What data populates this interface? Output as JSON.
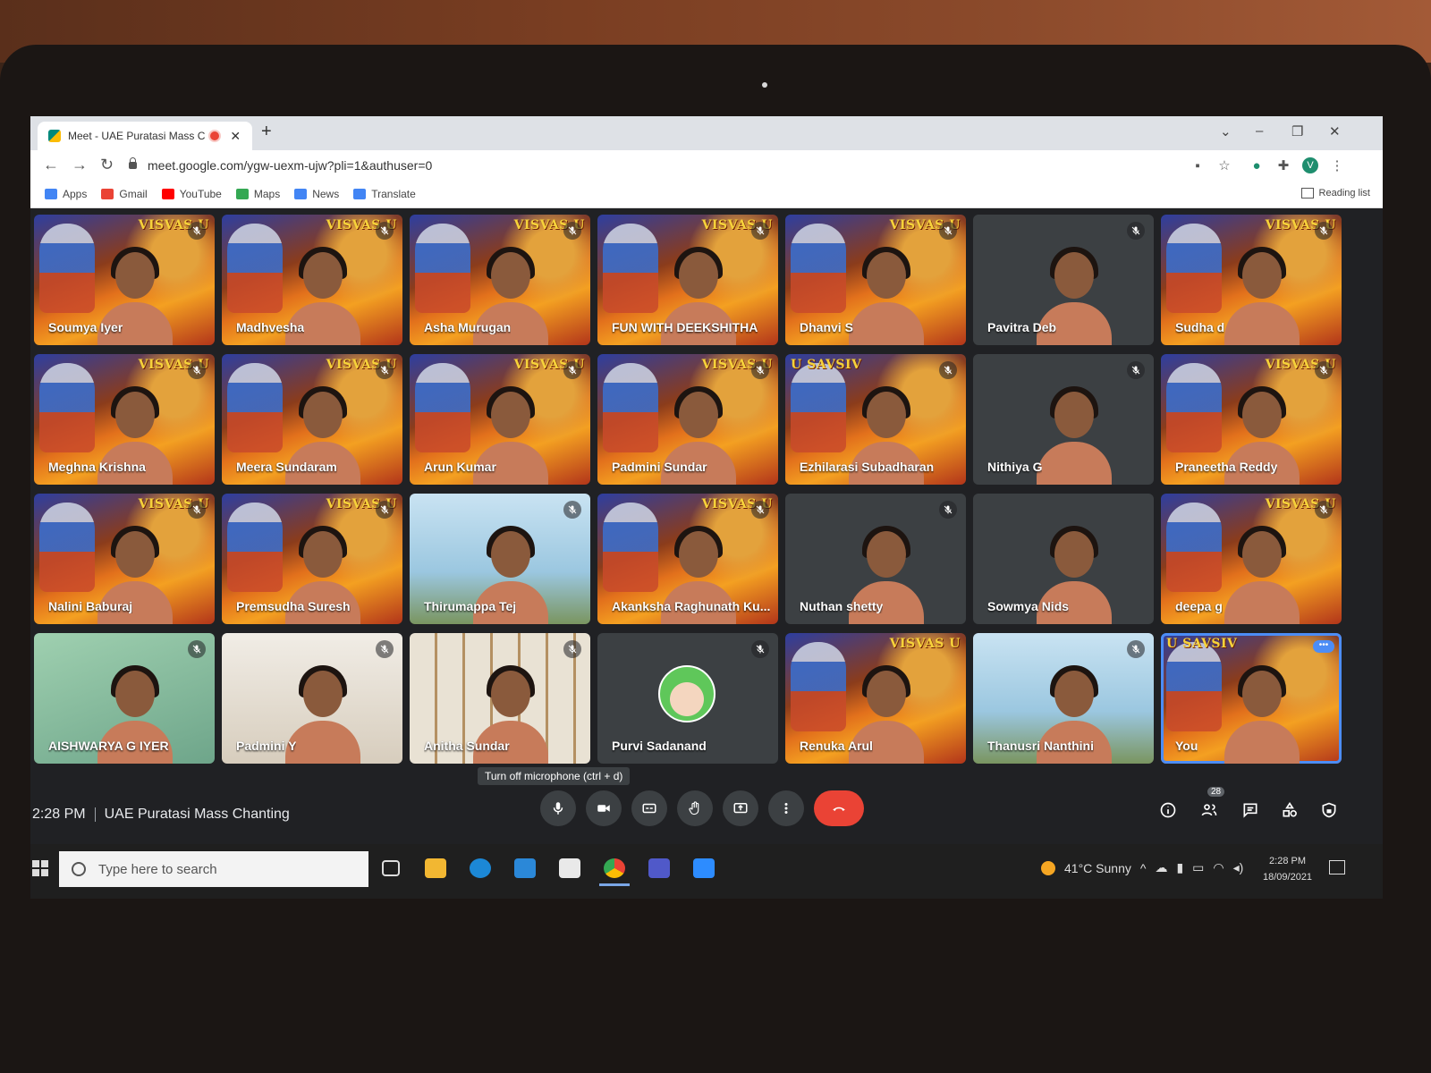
{
  "browser": {
    "tab_title": "Meet - UAE Puratasi Mass C",
    "new_tab": "+",
    "url": "meet.google.com/ygw-uexm-ujw?pli=1&authuser=0",
    "profile_initial": "V",
    "bookmarks": [
      {
        "label": "Apps",
        "icon": "apps-icon",
        "color": "#4285f4"
      },
      {
        "label": "Gmail",
        "icon": "gmail-icon",
        "color": "#ea4335"
      },
      {
        "label": "YouTube",
        "icon": "youtube-icon",
        "color": "#ff0000"
      },
      {
        "label": "Maps",
        "icon": "maps-icon",
        "color": "#34a853"
      },
      {
        "label": "News",
        "icon": "news-icon",
        "color": "#4285f4"
      },
      {
        "label": "Translate",
        "icon": "translate-icon",
        "color": "#4285f4"
      }
    ],
    "reading_list": "Reading list"
  },
  "meet": {
    "banner_text": "VISVAS U",
    "banner_text_mirrored": "U SAVSIV",
    "participants": [
      {
        "name": "Soumya Iyer",
        "bg": "banner",
        "muted": true
      },
      {
        "name": "Madhvesha",
        "bg": "banner",
        "muted": true
      },
      {
        "name": "Asha Murugan",
        "bg": "banner",
        "muted": true
      },
      {
        "name": "FUN WITH DEEKSHITHA",
        "bg": "banner",
        "muted": true
      },
      {
        "name": "Dhanvi S",
        "bg": "banner",
        "muted": true
      },
      {
        "name": "Pavitra Deb",
        "bg": "dark",
        "muted": true
      },
      {
        "name": "Sudha d",
        "bg": "banner",
        "muted": true
      },
      {
        "name": "Meghna Krishna",
        "bg": "banner",
        "muted": true
      },
      {
        "name": "Meera Sundaram",
        "bg": "banner",
        "muted": true
      },
      {
        "name": "Arun Kumar",
        "bg": "banner",
        "muted": true
      },
      {
        "name": "Padmini Sundar",
        "bg": "banner",
        "muted": true
      },
      {
        "name": "Ezhilarasi Subadharan",
        "bg": "banner-mirror",
        "muted": true
      },
      {
        "name": "Nithiya G",
        "bg": "dark",
        "muted": true
      },
      {
        "name": "Praneetha Reddy",
        "bg": "banner",
        "muted": true
      },
      {
        "name": "Nalini Baburaj",
        "bg": "banner",
        "muted": true
      },
      {
        "name": "Premsudha Suresh",
        "bg": "banner",
        "muted": true
      },
      {
        "name": "Thirumappa Tej",
        "bg": "sky",
        "muted": true
      },
      {
        "name": "Akanksha Raghunath Ku...",
        "bg": "banner",
        "muted": true
      },
      {
        "name": "Nuthan shetty",
        "bg": "dark",
        "muted": true
      },
      {
        "name": "Sowmya Nids",
        "bg": "dark",
        "muted": false
      },
      {
        "name": "deepa g",
        "bg": "banner",
        "muted": true
      },
      {
        "name": "AISHWARYA G IYER",
        "bg": "green",
        "muted": true
      },
      {
        "name": "Padmini Y",
        "bg": "beige",
        "muted": true
      },
      {
        "name": "Anitha Sundar",
        "bg": "shelf",
        "muted": true
      },
      {
        "name": "Purvi Sadanand",
        "bg": "avatar",
        "muted": true
      },
      {
        "name": "Renuka Arul",
        "bg": "banner",
        "muted": false
      },
      {
        "name": "Thanusri Nanthini",
        "bg": "sky",
        "muted": true
      },
      {
        "name": "You",
        "bg": "banner-mirror-self",
        "muted": false
      }
    ],
    "tooltip": "Turn off microphone (ctrl + d)",
    "time": "2:28 PM",
    "meeting_title": "UAE Puratasi Mass Chanting",
    "people_count": "28",
    "end_color": "#ea4335"
  },
  "taskbar": {
    "search_placeholder": "Type here to search",
    "weather": "41°C  Sunny",
    "clock_time": "2:28 PM",
    "clock_date": "18/09/2021"
  }
}
